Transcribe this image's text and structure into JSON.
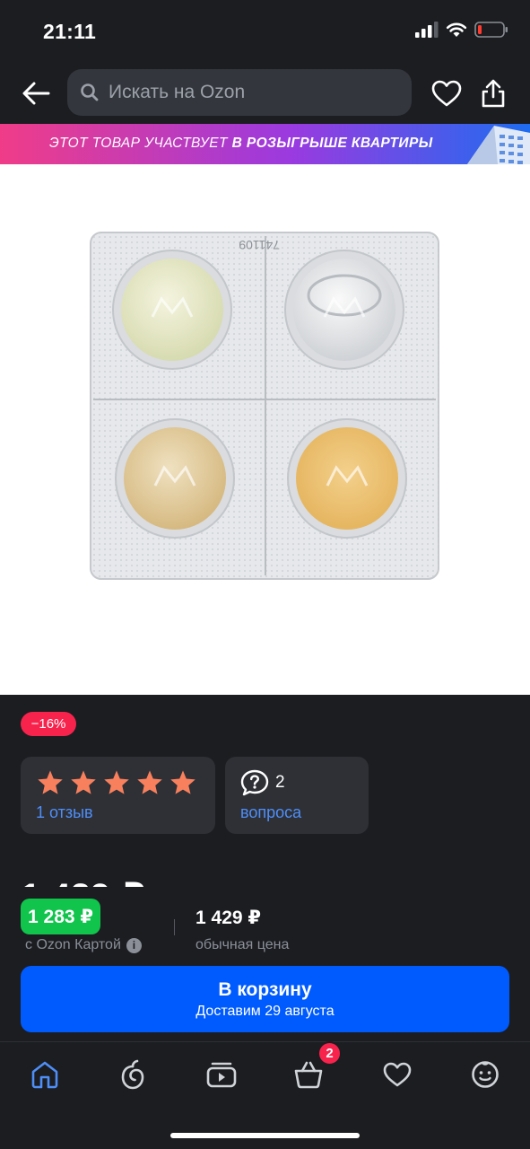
{
  "status_bar": {
    "time": "21:11"
  },
  "header": {
    "search_placeholder": "Искать на Ozon"
  },
  "promo": {
    "text_prefix": "ЭТОТ ТОВАР УЧАСТВУЕТ ",
    "text_bold": "В РОЗЫГРЫШЕ КВАРТИРЫ"
  },
  "product": {
    "discount": "−16%",
    "rating_stars": 5,
    "reviews_label": "1 отзыв",
    "questions_count": "2",
    "questions_label": "вопроса",
    "price_peek": "1 429 ₽"
  },
  "prices": {
    "ozon_card_price": "1 283 ₽",
    "ozon_card_label": "с Ozon Картой",
    "regular_price": "1 429 ₽",
    "regular_label": "обычная цена"
  },
  "cart_button": {
    "label": "В корзину",
    "delivery": "Доставим 29 августа"
  },
  "tabbar": {
    "items": [
      "home-icon",
      "fresh-icon",
      "video-icon",
      "cart-icon",
      "favorites-icon",
      "profile-icon"
    ],
    "cart_badge": "2",
    "active_color": "#4f8ef7"
  },
  "colors": {
    "accent_blue": "#005bff",
    "ozon_card_green": "#10c44c",
    "discount_red": "#f7234d",
    "star_orange": "#f9805d"
  }
}
